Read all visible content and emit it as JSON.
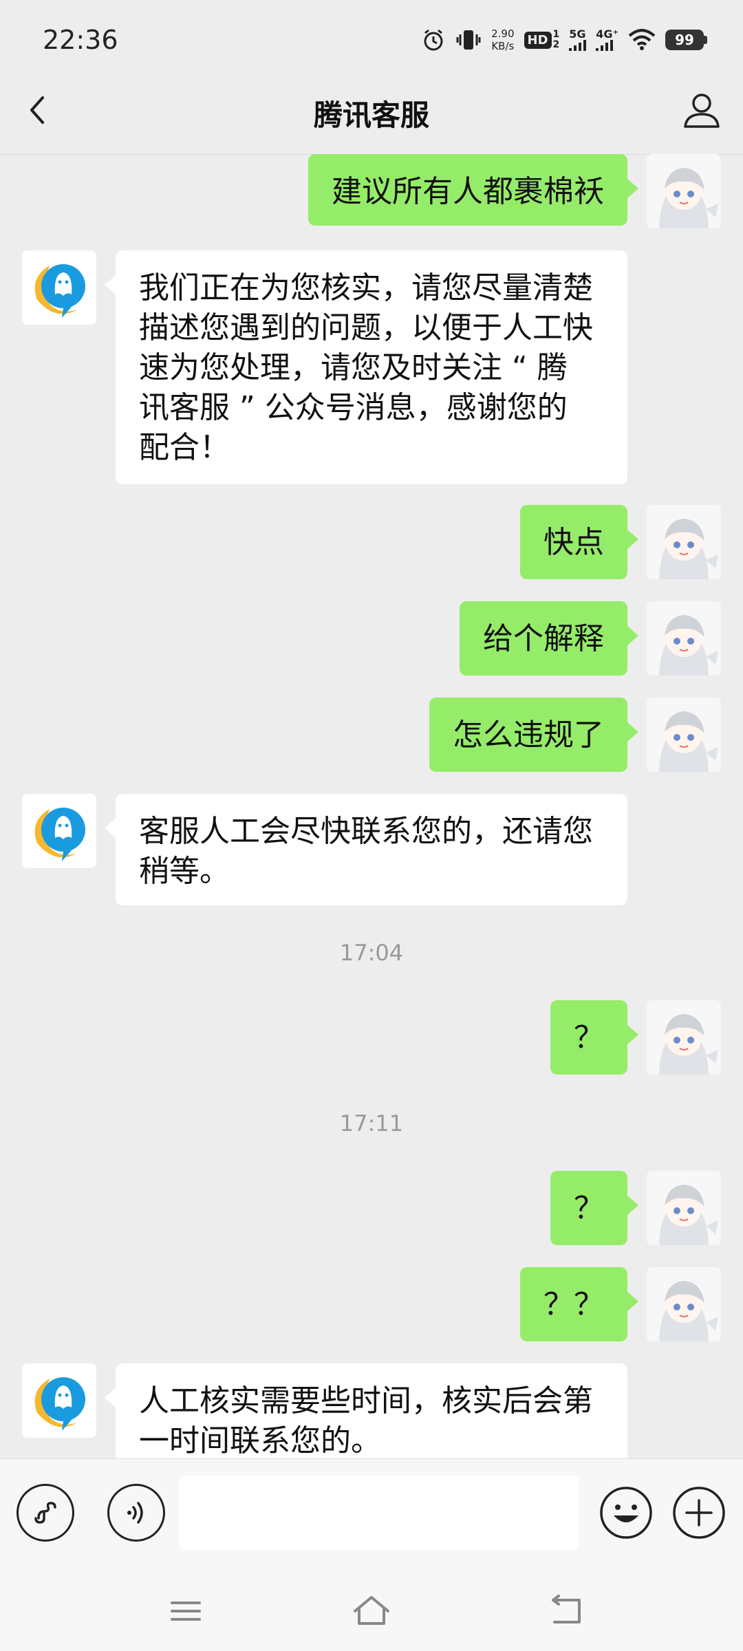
{
  "status_bar": {
    "time": "22:36",
    "net_speed_value": "2.90",
    "net_speed_unit": "KB/s",
    "hd_label": "HD",
    "hd_sub_top": "1",
    "hd_sub_bottom": "2",
    "signal_5g": "5G",
    "signal_4g": "4G⁺",
    "battery": "99",
    "icons": [
      "alarm-icon",
      "vibrate-icon",
      "wifi-icon"
    ]
  },
  "header": {
    "title": "腾讯客服",
    "back_icon": "chevron-left-icon",
    "profile_icon": "person-icon"
  },
  "messages": [
    {
      "type": "out",
      "text": "建议所有人都裹棉袄"
    },
    {
      "type": "in",
      "lines": [
        "我们正在为您核实，请您尽量清楚",
        "描述您遇到的问题，以便于人工快",
        "速为您处理，请您及时关注 “ 腾",
        "讯客服 ” 公众号消息，感谢您的",
        "配合！"
      ]
    },
    {
      "type": "out",
      "text": "快点"
    },
    {
      "type": "out",
      "text": "给个解释"
    },
    {
      "type": "out",
      "text": "怎么违规了"
    },
    {
      "type": "in",
      "lines": [
        "客服人工会尽快联系您的，还请您",
        "稍等。"
      ]
    },
    {
      "type": "time",
      "text": "17:04"
    },
    {
      "type": "out",
      "text": "？"
    },
    {
      "type": "time",
      "text": "17:11"
    },
    {
      "type": "out",
      "text": "？"
    },
    {
      "type": "out",
      "text": "？？"
    },
    {
      "type": "in",
      "lines": [
        "人工核实需要些时间，核实后会第",
        "一时间联系您的。"
      ]
    }
  ],
  "input_bar": {
    "value": "",
    "placeholder": "",
    "icons": [
      "mini-program-icon",
      "voice-icon",
      "emoji-icon",
      "plus-icon"
    ]
  },
  "system_nav": {
    "icons": [
      "menu-icon",
      "home-icon",
      "back-arrow-icon"
    ]
  },
  "colors": {
    "background": "#ededed",
    "outgoing_bubble": "#95ec69",
    "incoming_bubble": "#ffffff",
    "timestamp": "#999999"
  }
}
